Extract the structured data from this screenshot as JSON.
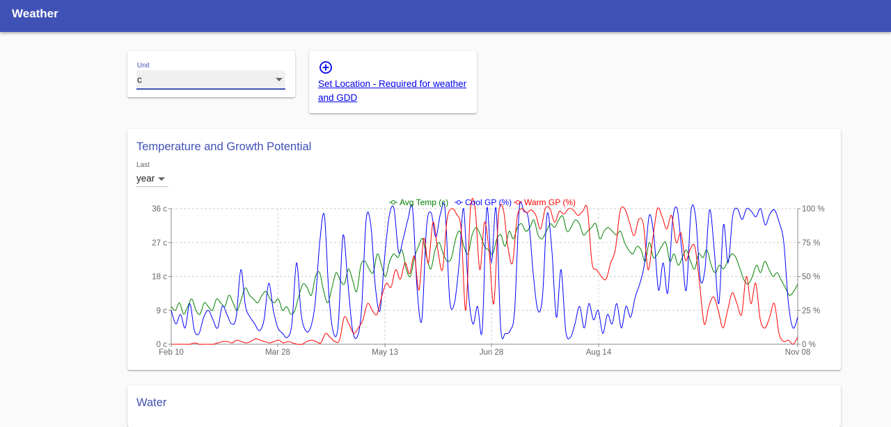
{
  "appbar": {
    "title": "Weather"
  },
  "unit_card": {
    "label": "Unit",
    "value": "c"
  },
  "location_card": {
    "icon": "add-circle-icon",
    "link_text": "Set Location - Required for weather and GDD"
  },
  "temperature_card": {
    "title": "Temperature and Growth Potential",
    "last_label": "Last",
    "last_value": "year"
  },
  "water_card": {
    "title": "Water"
  },
  "colors": {
    "primary": "#3f51b5",
    "avg_temp": "#008000",
    "cool_gp": "#0000ff",
    "warm_gp": "#ff0000",
    "link": "#0000ee"
  },
  "chart_data": {
    "type": "line",
    "legend_position": "top-center",
    "grid": true,
    "series": [
      {
        "name": "Avg Temp (c)",
        "axis": "left",
        "color": "#008000",
        "values": [
          10,
          9,
          11,
          8,
          10,
          12,
          9,
          8,
          11,
          10,
          9,
          12,
          11,
          10,
          13,
          11,
          9,
          12,
          15,
          13,
          12,
          11,
          13,
          14,
          12,
          11,
          12,
          9,
          10,
          8,
          9,
          13,
          16,
          15,
          13,
          18,
          19,
          14,
          11,
          15,
          19,
          17,
          16,
          20,
          17,
          14,
          21,
          22,
          20,
          19,
          24,
          21,
          18,
          22,
          24,
          23,
          25,
          20,
          18,
          23,
          26,
          28,
          23,
          20,
          25,
          27,
          24,
          22,
          23,
          28,
          30,
          26,
          24,
          29,
          31,
          29,
          26,
          25,
          24,
          28,
          29,
          26,
          30,
          28,
          31,
          32,
          30,
          31,
          33,
          29,
          28,
          30,
          32,
          31,
          33,
          34,
          30,
          31,
          33,
          32,
          29,
          30,
          31,
          32,
          28,
          30,
          31,
          30,
          29,
          30,
          27,
          25,
          24,
          26,
          25,
          22,
          27,
          23,
          24,
          26,
          27,
          22,
          24,
          21,
          23,
          25,
          22,
          20,
          24,
          23,
          25,
          21,
          19,
          21,
          20,
          22,
          24,
          23,
          20,
          17,
          16,
          18,
          21,
          19,
          22,
          20,
          18,
          19,
          17,
          15,
          13,
          14,
          16
        ]
      },
      {
        "name": "Cool GP (%)",
        "axis": "right",
        "color": "#0000ff",
        "values": [
          25,
          15,
          22,
          12,
          30,
          10,
          8,
          20,
          25,
          18,
          12,
          28,
          22,
          15,
          20,
          55,
          28,
          20,
          15,
          10,
          18,
          45,
          25,
          12,
          8,
          5,
          15,
          60,
          22,
          10,
          12,
          30,
          75,
          95,
          35,
          8,
          15,
          80,
          48,
          12,
          5,
          25,
          92,
          88,
          42,
          25,
          65,
          95,
          100,
          68,
          78,
          92,
          100,
          40,
          18,
          86,
          97,
          79,
          96,
          100,
          33,
          30,
          58,
          100,
          40,
          15,
          28,
          10,
          100,
          60,
          100,
          12,
          8,
          10,
          25,
          100,
          98,
          92,
          52,
          25,
          35,
          96,
          70,
          20,
          55,
          10,
          5,
          15,
          28,
          12,
          30,
          18,
          25,
          8,
          22,
          15,
          30,
          12,
          28,
          20,
          35,
          45,
          60,
          95,
          80,
          40,
          60,
          38,
          90,
          100,
          70,
          40,
          98,
          94,
          48,
          55,
          99,
          70,
          30,
          88,
          60,
          95,
          100,
          92,
          100,
          98,
          94,
          100,
          88,
          96,
          99,
          90,
          75,
          30,
          12,
          20
        ]
      },
      {
        "name": "Warm GP (%)",
        "axis": "right",
        "color": "#ff0000",
        "values": [
          0,
          0,
          0,
          0,
          0,
          1,
          0,
          0,
          0,
          0,
          1,
          2,
          2,
          1,
          3,
          2,
          1,
          2,
          4,
          3,
          2,
          1,
          2,
          3,
          1,
          2,
          1,
          0,
          0,
          2,
          3,
          2,
          1,
          8,
          5,
          2,
          3,
          20,
          15,
          8,
          12,
          18,
          30,
          25,
          22,
          35,
          45,
          42,
          55,
          48,
          60,
          52,
          65,
          40,
          78,
          60,
          90,
          70,
          55,
          92,
          100,
          96,
          85,
          25,
          100,
          100,
          55,
          90,
          68,
          30,
          95,
          100,
          72,
          60,
          94,
          100,
          97,
          99,
          95,
          85,
          100,
          100,
          90,
          98,
          96,
          100,
          99,
          95,
          98,
          100,
          60,
          55,
          50,
          48,
          60,
          70,
          98,
          100,
          90,
          80,
          92,
          88,
          55,
          78,
          100,
          94,
          85,
          95,
          75,
          82,
          62,
          70,
          72,
          45,
          15,
          28,
          35,
          25,
          12,
          25,
          38,
          30,
          22,
          50,
          30,
          45,
          18,
          12,
          20,
          30,
          8,
          2,
          3,
          0,
          5
        ]
      }
    ],
    "x_tick_labels": [
      "Feb 10",
      "Mar 28",
      "May 13",
      "Jun 28",
      "Aug 14",
      "Nov 08"
    ],
    "y_left": {
      "ticks": [
        "0 c",
        "9 c",
        "18 c",
        "27 c",
        "36 c"
      ],
      "range": [
        0,
        36
      ],
      "unit": "c"
    },
    "y_right": {
      "ticks": [
        "0 %",
        "25 %",
        "50 %",
        "75 %",
        "100 %"
      ],
      "range": [
        0,
        100
      ],
      "unit": "%"
    }
  }
}
